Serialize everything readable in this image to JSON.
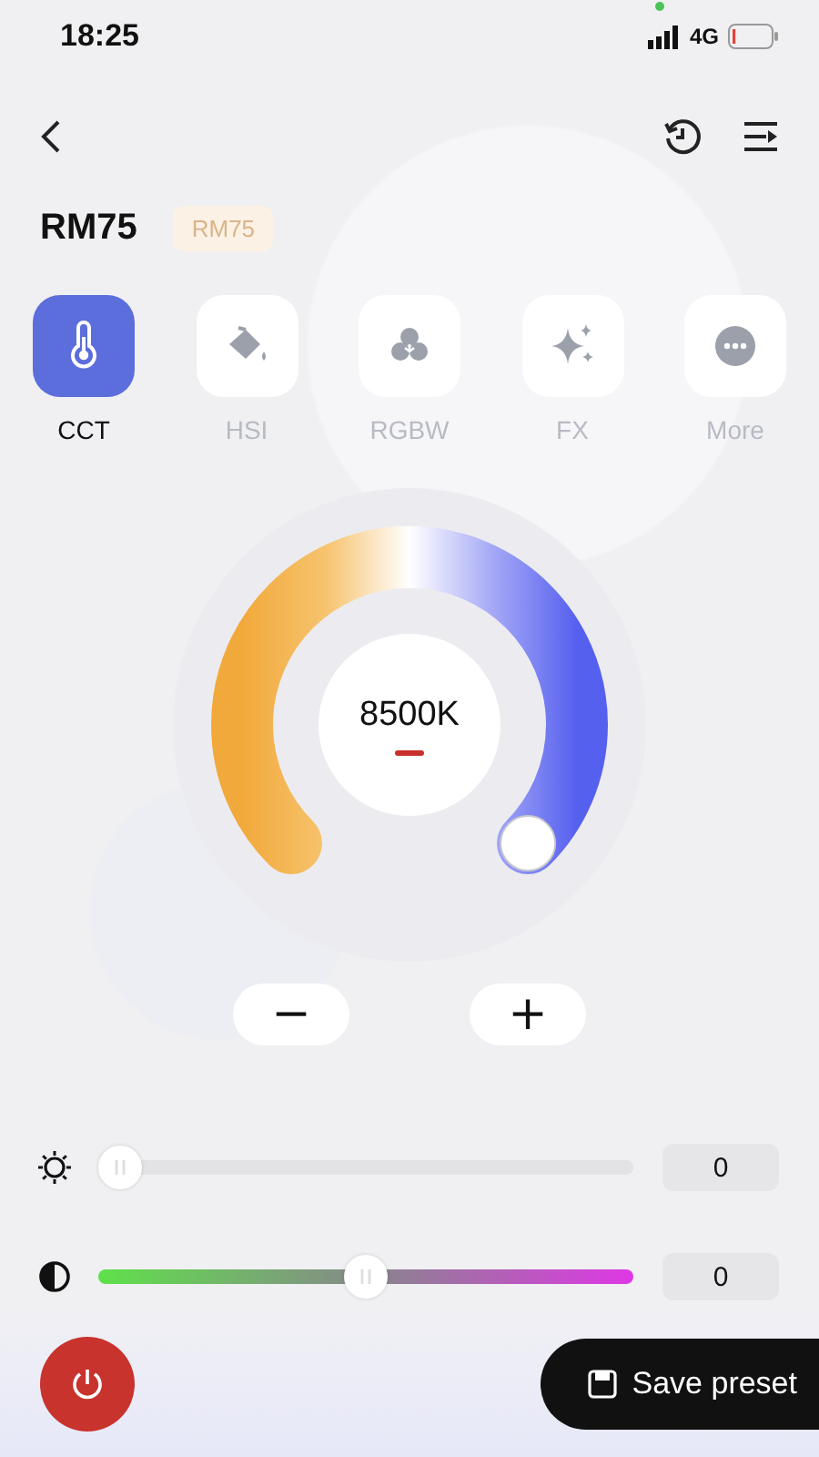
{
  "status_bar": {
    "time": "18:25",
    "network": "4G"
  },
  "header": {
    "title": "RM75",
    "badge": "RM75"
  },
  "modes": [
    {
      "kind": "thermometer",
      "label": "CCT",
      "selected": true
    },
    {
      "kind": "bucket",
      "label": "HSI",
      "selected": false
    },
    {
      "kind": "circles",
      "label": "RGBW",
      "selected": false
    },
    {
      "kind": "sparkle",
      "label": "FX",
      "selected": false
    },
    {
      "kind": "dots",
      "label": "More",
      "selected": false
    }
  ],
  "dial": {
    "reading": "8500K"
  },
  "step_buttons": [
    {
      "label": "−"
    },
    {
      "label": "+"
    }
  ],
  "sliders": [
    {
      "kind": "brightness",
      "level": 0,
      "reading": "0"
    },
    {
      "kind": "tint",
      "level": 0.5,
      "reading": "0"
    }
  ],
  "save_button": {
    "label": "Save preset"
  }
}
